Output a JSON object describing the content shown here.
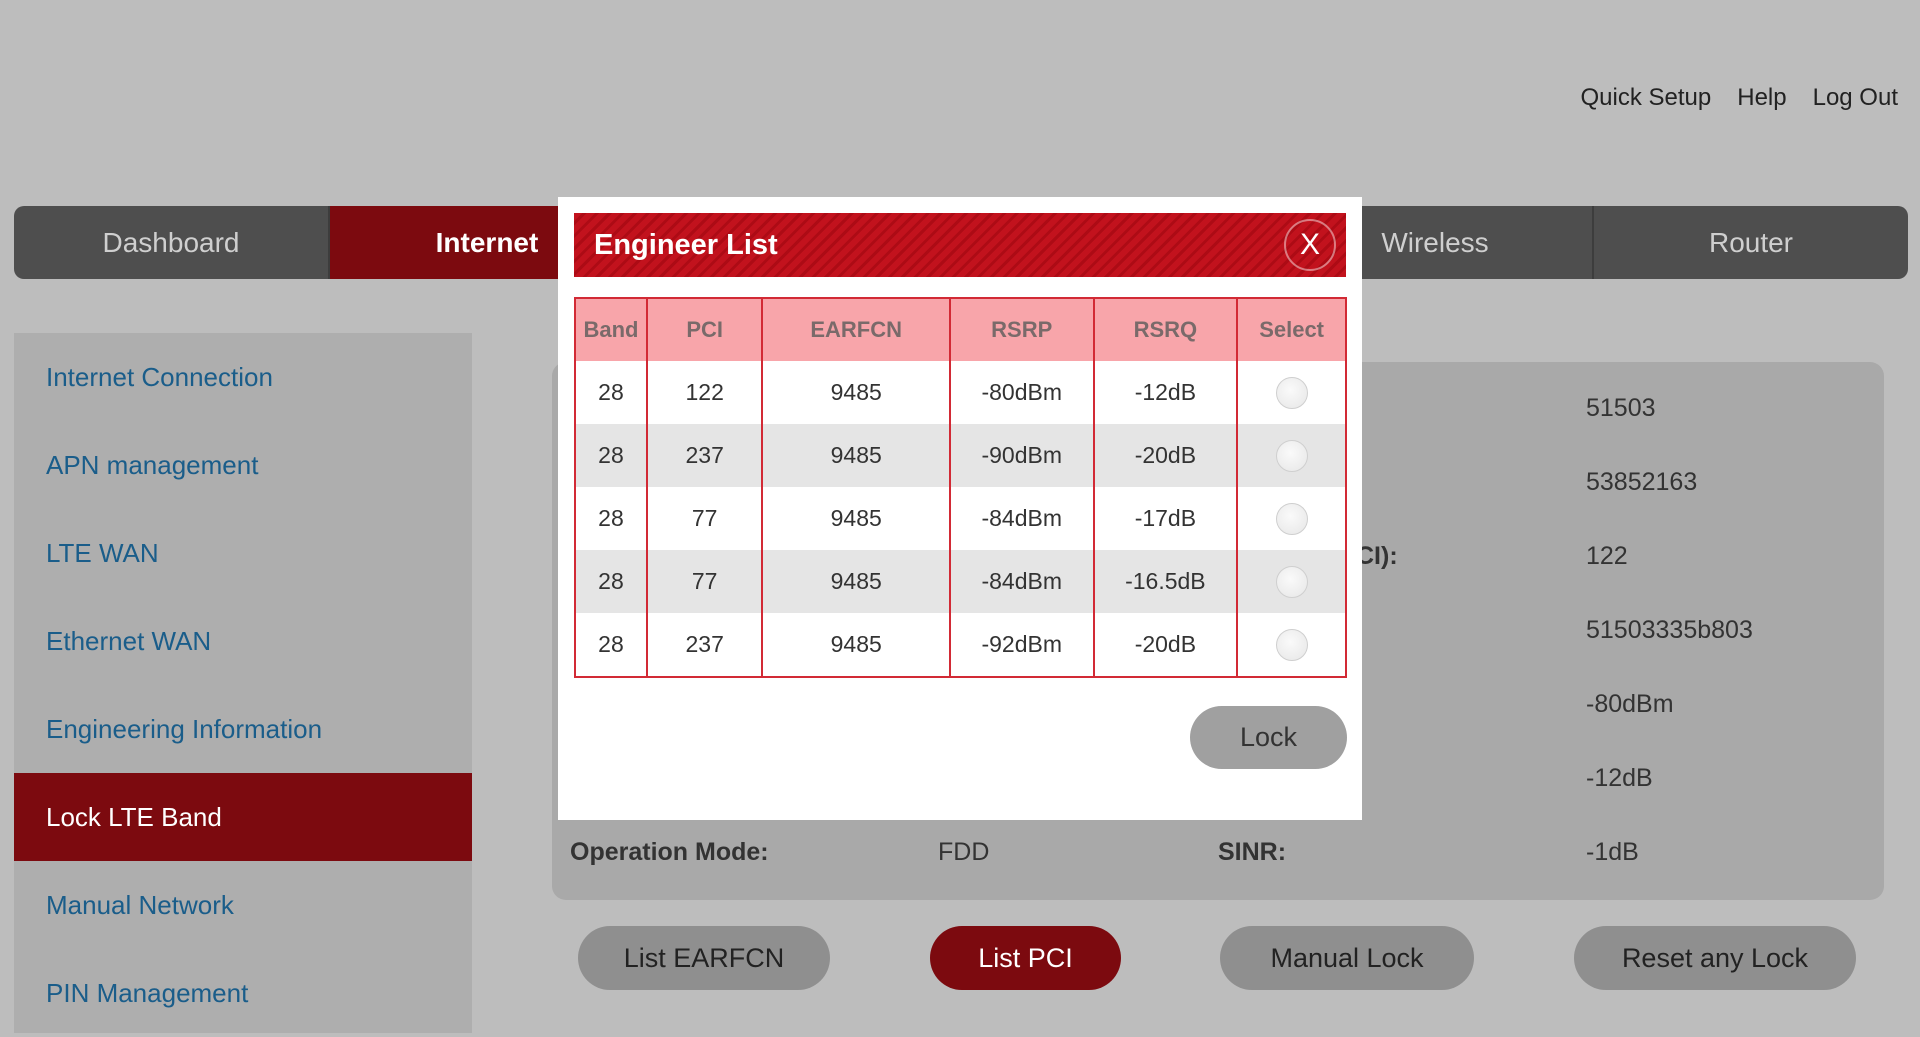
{
  "top_links": [
    "Quick Setup",
    "Help",
    "Log Out"
  ],
  "nav_tabs": [
    "Dashboard",
    "Internet",
    "",
    "",
    "Wireless",
    "Router"
  ],
  "sidebar": [
    "Internet Connection",
    "APN management",
    "LTE WAN",
    "Ethernet WAN",
    "Engineering Information",
    "Lock LTE Band",
    "Manual Network",
    "PIN Management"
  ],
  "panel": {
    "right_values": [
      "51503",
      "53852163",
      "122",
      "51503335b803",
      "-80dBm",
      "-12dB",
      "-1dB"
    ],
    "partial_label": "CI):",
    "operation_mode_label": "Operation Mode:",
    "operation_mode_value": "FDD",
    "sinr_label": "SINR:"
  },
  "buttons": [
    "List EARFCN",
    "List PCI",
    "Manual Lock",
    "Reset any Lock"
  ],
  "modal": {
    "title": "Engineer List",
    "close": "X",
    "headers": [
      "Band",
      "PCI",
      "EARFCN",
      "RSRP",
      "RSRQ",
      "Select"
    ],
    "rows": [
      [
        "28",
        "122",
        "9485",
        "-80dBm",
        "-12dB"
      ],
      [
        "28",
        "237",
        "9485",
        "-90dBm",
        "-20dB"
      ],
      [
        "28",
        "77",
        "9485",
        "-84dBm",
        "-17dB"
      ],
      [
        "28",
        "77",
        "9485",
        "-84dBm",
        "-16.5dB"
      ],
      [
        "28",
        "237",
        "9485",
        "-92dBm",
        "-20dB"
      ]
    ],
    "lock": "Lock"
  }
}
